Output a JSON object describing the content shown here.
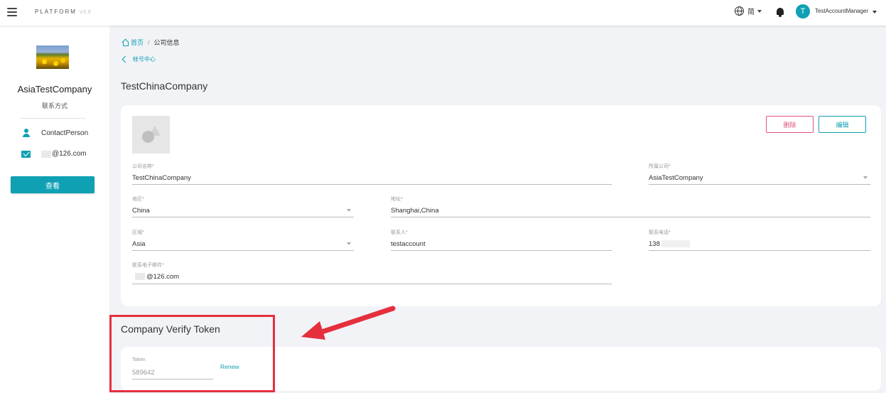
{
  "topbar": {
    "brand": "PLATFORM",
    "version": "V3.6",
    "language": "简",
    "avatar_letter": "T",
    "account_name": "TestAccountManager"
  },
  "sidebar": {
    "company_name": "AsiaTestCompany",
    "section_label": "联系方式",
    "contact_person": "ContactPerson",
    "email_suffix": "@126.com",
    "view_button": "查看"
  },
  "breadcrumb": {
    "home": "首页",
    "separator": "/",
    "current": "公司信息"
  },
  "back_link": "帐号中心",
  "page_title": "TestChinaCompany",
  "actions": {
    "delete": "删除",
    "edit": "编辑"
  },
  "form": {
    "company_name": {
      "label": "公司名称*",
      "value": "TestChinaCompany"
    },
    "parent_company": {
      "label": "所属公司*",
      "value": "AsiaTestCompany"
    },
    "country": {
      "label": "地区*",
      "value": "China"
    },
    "address": {
      "label": "地址*",
      "value": "Shanghai,China"
    },
    "region": {
      "label": "区域*",
      "value": "Asia"
    },
    "contact": {
      "label": "联系人*",
      "value": "testaccount"
    },
    "phone": {
      "label": "联系电话*",
      "value": "138"
    },
    "email": {
      "label": "联系电子邮件*",
      "value": "@126.com"
    }
  },
  "token_section": {
    "title": "Company Verify Token",
    "label": "Token",
    "value": "589642",
    "renew": "Renew"
  },
  "colors": {
    "accent": "#0fa0b4",
    "danger": "#e0527a",
    "highlight": "#e52f3d"
  }
}
